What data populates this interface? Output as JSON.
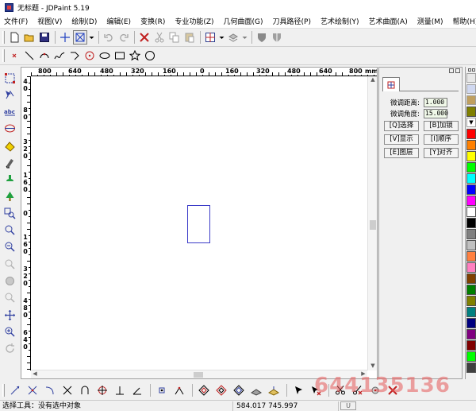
{
  "window": {
    "title": "无标题 - JDPaint 5.19"
  },
  "menu": [
    "文件(F)",
    "视图(V)",
    "绘制(D)",
    "编辑(E)",
    "变换(R)",
    "专业功能(Z)",
    "几何曲面(G)",
    "刀具路径(P)",
    "艺术绘制(Y)",
    "艺术曲面(A)",
    "测量(M)",
    "帮助(H)"
  ],
  "toolbar_top": {
    "icons": [
      "new-file",
      "open-folder",
      "save-disk",
      "crosshair",
      "select-box",
      "dropdown",
      "undo",
      "redo",
      "delete-x",
      "cut",
      "copy",
      "paste",
      "grid-view",
      "dropdown",
      "layer-view",
      "dropdown",
      "shield-left",
      "shield-right"
    ]
  },
  "toolbar_draw": {
    "icons": [
      "point",
      "line",
      "arc",
      "spline",
      "polyline",
      "circle-point",
      "ellipse",
      "rectangle",
      "star",
      "circle"
    ]
  },
  "left_tools": [
    "select",
    "node-edit",
    "text",
    "transform",
    "mirror",
    "erase",
    "fill",
    "tree",
    "zoom-window",
    "zoom-in",
    "zoom-out",
    "zoom-prev",
    "zoom-all",
    "zoom-real",
    "pan",
    "zoom-fit",
    "refresh"
  ],
  "ruler": {
    "h_labels": [
      "800",
      "640",
      "480",
      "320",
      "160",
      "0",
      "160",
      "320",
      "480",
      "640",
      "800",
      "mm"
    ],
    "v_labels": [
      "40",
      "80",
      "320",
      "160",
      "0",
      "160",
      "320",
      "480",
      "640"
    ]
  },
  "panel": {
    "fine_distance_label": "微调距离:",
    "fine_distance_value": "1.000",
    "fine_angle_label": "微调角度:",
    "fine_angle_value": "15.000",
    "buttons": [
      "[Q]选择",
      "[B]加锁",
      "[V]显示",
      "[I]顺序",
      "[E]图层",
      "[Y]对齐"
    ]
  },
  "colors": [
    "#ff0000",
    "#ff8000",
    "#ffff00",
    "#00ff00",
    "#00ffff",
    "#0000ff",
    "#ff00ff",
    "#ffffff",
    "#000000",
    "#808080",
    "#c0c0c0",
    "#ff8040",
    "#ff80c0",
    "#804000",
    "#008000",
    "#808000",
    "#008080",
    "#000080",
    "#800080",
    "#800000",
    "#00ff00",
    "#404040"
  ],
  "bottom_tools": [
    "line-extend",
    "break",
    "arc-trim",
    "cross-trim",
    "arc-join",
    "circle-center",
    "line-perp",
    "angle-line",
    "node",
    "corner",
    "offset",
    "offset2",
    "offset3",
    "fill-area",
    "fill-area2",
    "pointer",
    "pointer-x",
    "scissor",
    "scissor-x",
    "node-move",
    "delete-x"
  ],
  "status": {
    "message": "选择工具：没有选中对象",
    "coords": "584.017  745.997",
    "indicator": "U"
  },
  "watermark": "644135136"
}
